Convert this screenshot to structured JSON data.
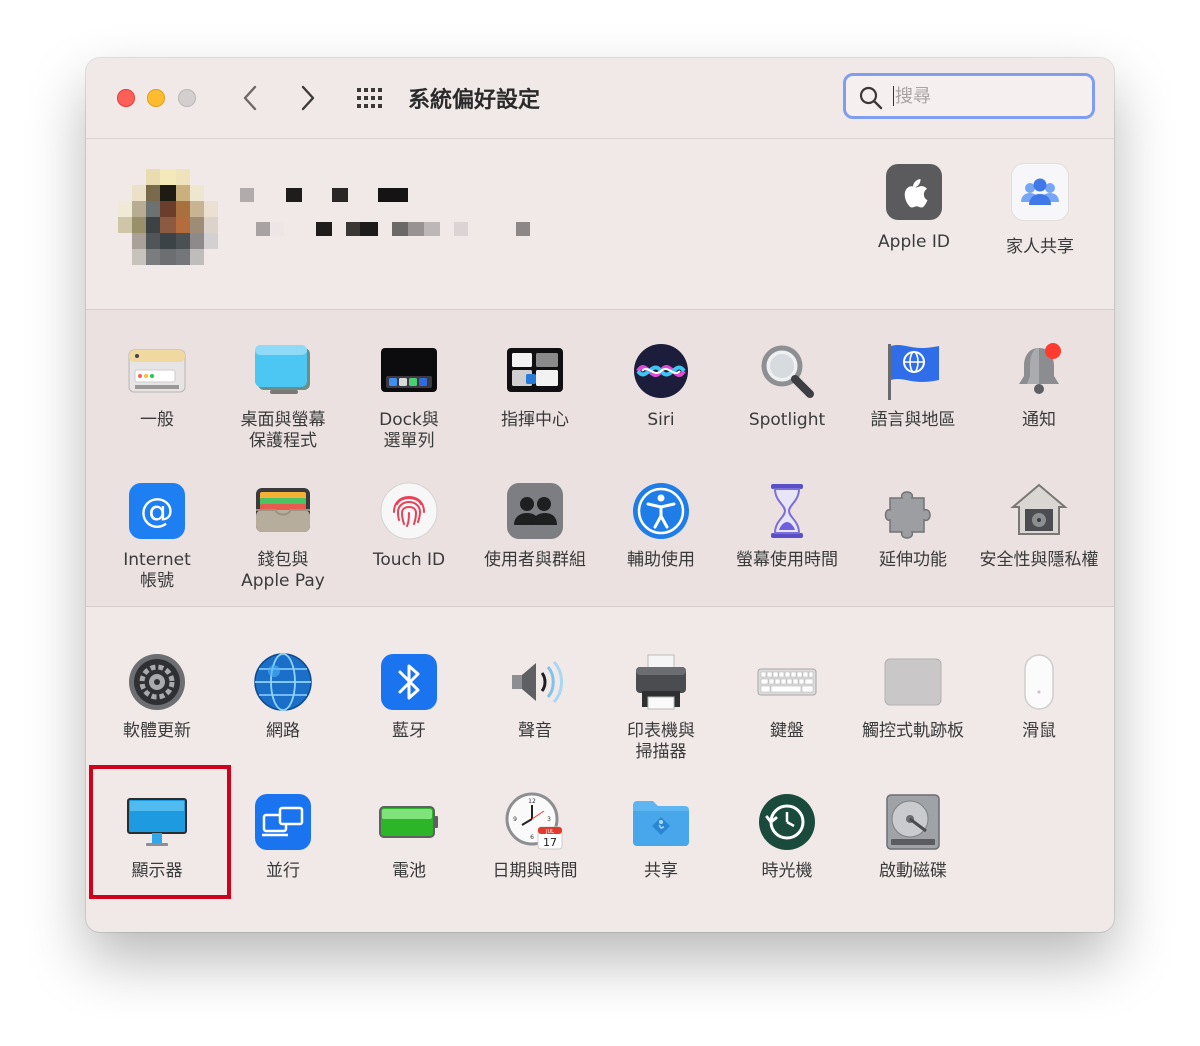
{
  "window": {
    "title": "系統偏好設定"
  },
  "search": {
    "placeholder": "搜尋"
  },
  "account_items": [
    {
      "name": "apple-id-item",
      "icon": "apple-logo-icon",
      "label": "Apple ID"
    },
    {
      "name": "family-sharing-item",
      "icon": "family-icon",
      "label": "家人共享"
    }
  ],
  "section1": [
    {
      "name": "pane-general",
      "icon": "general-icon",
      "label": "一般"
    },
    {
      "name": "pane-desktop-screensaver",
      "icon": "desktop-screensaver-icon",
      "label": "桌面與螢幕\n保護程式"
    },
    {
      "name": "pane-dock",
      "icon": "dock-icon",
      "label": "Dock與\n選單列"
    },
    {
      "name": "pane-mission-control",
      "icon": "mission-control-icon",
      "label": "指揮中心"
    },
    {
      "name": "pane-siri",
      "icon": "siri-icon",
      "label": "Siri"
    },
    {
      "name": "pane-spotlight",
      "icon": "magnifier-icon",
      "label": "Spotlight"
    },
    {
      "name": "pane-language-region",
      "icon": "flag-icon",
      "label": "語言與地區"
    },
    {
      "name": "pane-notifications",
      "icon": "bell-icon",
      "label": "通知"
    },
    {
      "name": "pane-internet-accounts",
      "icon": "at-sign-icon",
      "label": "Internet\n帳號"
    },
    {
      "name": "pane-wallet",
      "icon": "wallet-icon",
      "label": "錢包與\nApple Pay"
    },
    {
      "name": "pane-touch-id",
      "icon": "fingerprint-icon",
      "label": "Touch ID"
    },
    {
      "name": "pane-users-groups",
      "icon": "users-icon",
      "label": "使用者與群組"
    },
    {
      "name": "pane-accessibility",
      "icon": "accessibility-icon",
      "label": "輔助使用"
    },
    {
      "name": "pane-screen-time",
      "icon": "hourglass-icon",
      "label": "螢幕使用時間"
    },
    {
      "name": "pane-extensions",
      "icon": "puzzle-icon",
      "label": "延伸功能"
    },
    {
      "name": "pane-security-privacy",
      "icon": "house-safe-icon",
      "label": "安全性與隱私權"
    }
  ],
  "section2": [
    {
      "name": "pane-software-update",
      "icon": "gear-icon",
      "label": "軟體更新"
    },
    {
      "name": "pane-network",
      "icon": "globe-icon",
      "label": "網路"
    },
    {
      "name": "pane-bluetooth",
      "icon": "bluetooth-icon",
      "label": "藍牙"
    },
    {
      "name": "pane-sound",
      "icon": "speaker-icon",
      "label": "聲音"
    },
    {
      "name": "pane-printers-scanners",
      "icon": "printer-icon",
      "label": "印表機與\n掃描器"
    },
    {
      "name": "pane-keyboard",
      "icon": "keyboard-icon",
      "label": "鍵盤"
    },
    {
      "name": "pane-trackpad",
      "icon": "trackpad-icon",
      "label": "觸控式軌跡板"
    },
    {
      "name": "pane-mouse",
      "icon": "mouse-icon",
      "label": "滑鼠"
    },
    {
      "name": "pane-displays",
      "icon": "display-icon",
      "label": "顯示器"
    },
    {
      "name": "pane-sidecar",
      "icon": "sidecar-icon",
      "label": "並行"
    },
    {
      "name": "pane-battery",
      "icon": "battery-icon",
      "label": "電池"
    },
    {
      "name": "pane-date-time",
      "icon": "clock-calendar-icon",
      "label": "日期與時間"
    },
    {
      "name": "pane-sharing",
      "icon": "shared-folder-icon",
      "label": "共享"
    },
    {
      "name": "pane-time-machine",
      "icon": "time-machine-icon",
      "label": "時光機"
    },
    {
      "name": "pane-startup-disk",
      "icon": "hard-disk-icon",
      "label": "啟動磁碟"
    }
  ],
  "calendar_icon": {
    "month": "JUL",
    "day": "17"
  },
  "accent": {
    "highlight": "#d0021b",
    "search_ring": "#7f9ef0"
  }
}
